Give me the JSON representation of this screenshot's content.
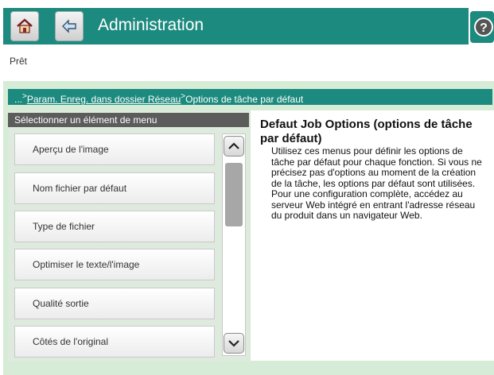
{
  "header": {
    "title": "Administration",
    "home_icon": "home-icon",
    "back_icon": "back-arrow-icon",
    "help_icon": "help-icon",
    "accent_color": "#1c8a7e"
  },
  "status": {
    "text": "Prêt"
  },
  "breadcrumb": {
    "prefix": "...",
    "sep1": ">",
    "link": "Param. Enreg. dans dossier Réseau",
    "sep2": ">",
    "current": "Options de tâche par défaut"
  },
  "menu": {
    "header": "Sélectionner un élément de menu",
    "items": [
      "Aperçu de l'image",
      "Nom fichier par défaut",
      "Type de fichier",
      "Optimiser le texte/l'image",
      "Qualité sortie",
      "Côtés de l'original"
    ]
  },
  "help": {
    "title": "Defaut Job Options (options de tâche par défaut)",
    "body": "Utilisez ces menus pour définir les options de tâche par défaut pour chaque fonction. Si vous ne précisez pas d'options au moment de la création de la tâche, les options par défaut sont utilisées. Pour une configuration complète, accédez au serveur Web intégré en entrant l'adresse réseau du produit dans un navigateur Web."
  }
}
